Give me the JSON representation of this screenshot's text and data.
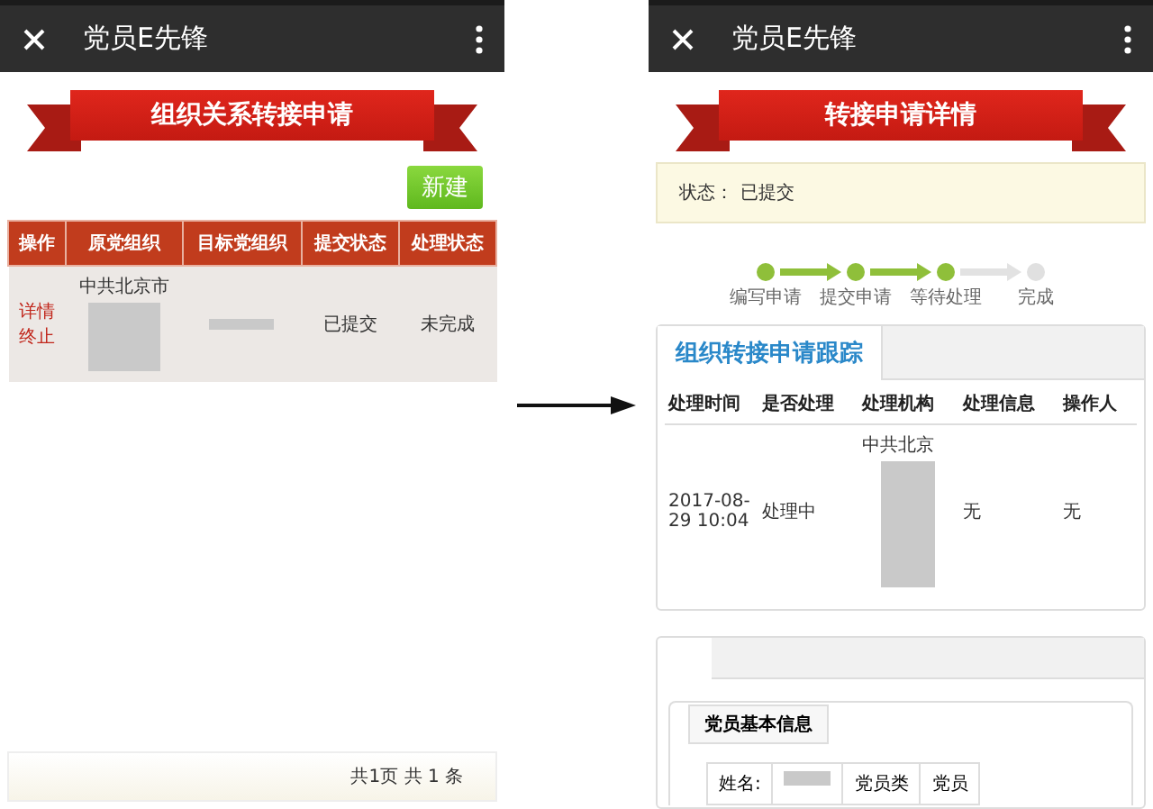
{
  "left_screen": {
    "app_bar": {
      "title": "党员E先锋"
    },
    "banner": {
      "title": "组织关系转接申请"
    },
    "new_button": "新建",
    "table": {
      "columns": [
        "操作",
        "原党组织",
        "目标党组织",
        "提交状态",
        "处理状态"
      ],
      "rows": [
        {
          "cells": [
            {
              "links": [
                "详情",
                "终止"
              ],
              "redacted": false
            },
            {
              "text": "中共北京市",
              "redacted": true
            },
            {
              "redacted": true
            },
            {
              "text": "已提交",
              "redacted": false
            },
            {
              "text": "未完成",
              "redacted": false
            }
          ]
        }
      ]
    },
    "pagination": "共1页 共 1 条"
  },
  "right_screen": {
    "app_bar": {
      "title": "党员E先锋"
    },
    "banner": {
      "title": "转接申请详情"
    },
    "status": {
      "label": "状态：",
      "value": "已提交"
    },
    "steps": [
      {
        "label": "编写申请",
        "done": true
      },
      {
        "label": "提交申请",
        "done": true
      },
      {
        "label": "等待处理",
        "done": true
      },
      {
        "label": "完成",
        "done": false
      }
    ],
    "tracking_card": {
      "tab": "组织转接申请跟踪",
      "columns": [
        "处理时间",
        "是否处理",
        "处理机构",
        "处理信息",
        "操作人"
      ],
      "rows": [
        {
          "cells": [
            {
              "text": "2017-08-29 10:04",
              "redacted": false
            },
            {
              "text": "处理中",
              "redacted": false
            },
            {
              "text": "中共北京",
              "redacted": true
            },
            {
              "text": "无",
              "redacted": false
            },
            {
              "text": "无",
              "redacted": false
            }
          ]
        }
      ]
    },
    "info_card": {
      "legend": "党员基本信息",
      "fields": [
        {
          "label": "姓名:",
          "redacted": true
        },
        {
          "label": "党员类",
          "value": "党员",
          "redacted": false
        }
      ]
    }
  }
}
